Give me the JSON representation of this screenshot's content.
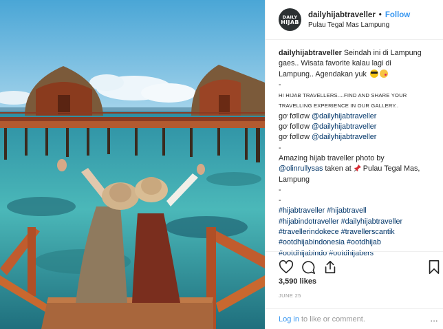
{
  "header": {
    "avatar_line1": "DAILY",
    "avatar_line2": "HIJAB",
    "username": "dailyhijabtraveller",
    "separator": "•",
    "follow_label": "Follow",
    "location": "Pulau Tegal Mas Lampung"
  },
  "caption": {
    "author": "dailyhijabtraveller",
    "line1": "Seindah ini di Lampung",
    "line2": "gaes.. Wisata favorite kalau lagi di",
    "line3": "Lampung.. Agendakan yuk",
    "dash1": "-",
    "invite_line1": "HI HIJAB TRAVELLERS....FIND AND SHARE YOUR",
    "invite_line2": "TRAVELLING EXPERIENCE IN OUR GALLERY..",
    "follow_prefix": "ɡơ fσllσw",
    "mention_account": "@dailyhijabtraveller",
    "dash2": "-",
    "credit_line1": "Amazing hijab traveller photo by",
    "credit_mention": "@olinrullysas",
    "credit_taken_at": "taken at",
    "credit_place": "Pulau Tegal Mas,",
    "credit_place2": "Lampung",
    "dash3": "-",
    "dash4": "-",
    "hashtags_line1": "#hijabtraveller #hijabtravell",
    "hashtags_line2": "#hijabindotraveller #dailyhijabtraveller",
    "hashtags_line3": "#travellerindokece #travellerscantik",
    "hashtags_line4": "#ootdhijabindonesia #ootdhijab",
    "hashtags_line5": "#ootdhijabindo #ootdhijabers"
  },
  "actions": {
    "like_icon": "heart-icon",
    "comment_icon": "comment-bubble-icon",
    "share_icon": "share-icon",
    "save_icon": "bookmark-icon"
  },
  "likes": "3,590 likes",
  "date": "JUNE 25",
  "comment_bar": {
    "login_label": "Log in",
    "suffix": "to like or comment.",
    "more_label": "..."
  },
  "colors": {
    "link_blue": "#3897f0",
    "hashtag_blue": "#003569",
    "muted_gray": "#999999",
    "text": "#262626"
  }
}
